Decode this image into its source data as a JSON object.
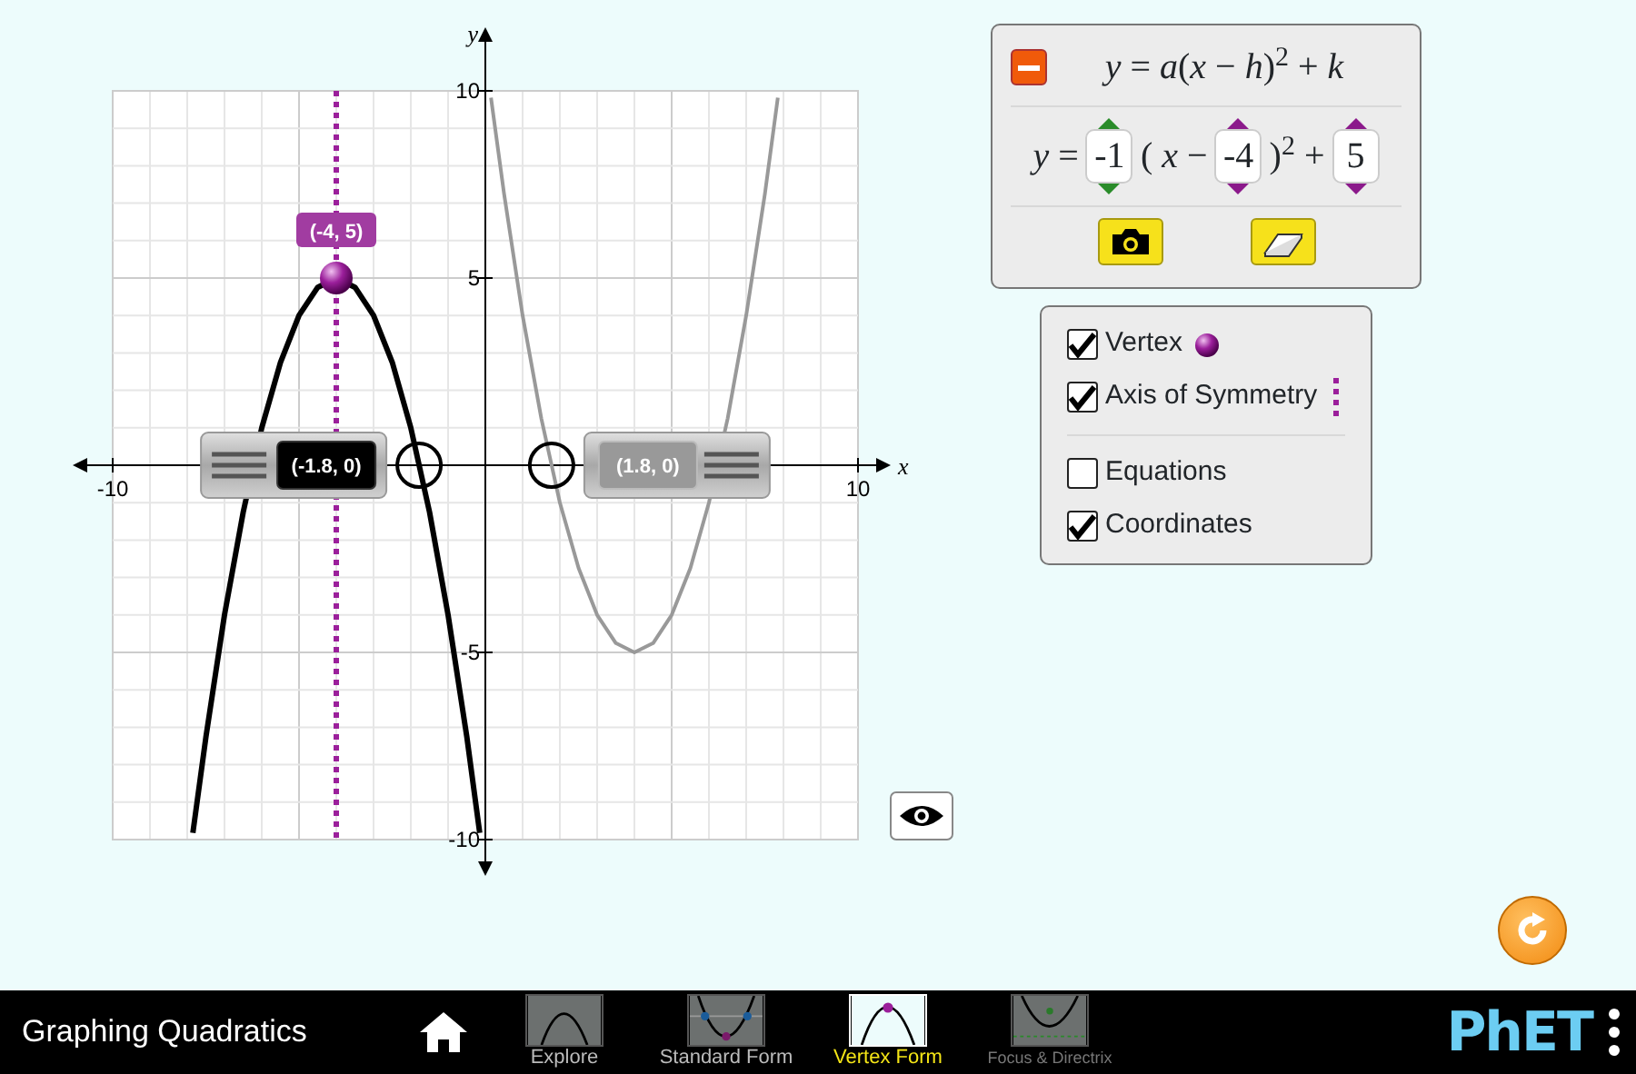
{
  "graph": {
    "chart_data": {
      "type": "line",
      "xlabel": "x",
      "ylabel": "y",
      "xlim": [
        -10,
        10
      ],
      "ylim": [
        -10,
        10
      ],
      "xticks": [
        -10,
        10
      ],
      "yticks": [
        -10,
        -5,
        5,
        10
      ],
      "x": [
        -7.85,
        -7.5,
        -7,
        -6.5,
        -6,
        -5.5,
        -5,
        -4.5,
        -4,
        -3.5,
        -3,
        -2.5,
        -2,
        -1.5,
        -1,
        -0.5,
        -0.15,
        0.15,
        0.5,
        1,
        1.5,
        2,
        2.5,
        3,
        3.5,
        4,
        4.5,
        5,
        5.5,
        6,
        6.5,
        7,
        7.5,
        7.85
      ],
      "series": [
        {
          "color": "#000000",
          "values": [
            -9.82,
            -7.25,
            -4,
            -1.25,
            1,
            2.75,
            4,
            4.75,
            5,
            4.75,
            4,
            2.75,
            1,
            -1.25,
            -4,
            -7.25,
            -9.82,
            null,
            null,
            null,
            null,
            null,
            null,
            null,
            null,
            null,
            null,
            null,
            null,
            null,
            null,
            null,
            null,
            null
          ]
        },
        {
          "color": "#999999",
          "values": [
            null,
            null,
            null,
            null,
            null,
            null,
            null,
            null,
            null,
            null,
            null,
            null,
            null,
            null,
            null,
            null,
            null,
            9.82,
            7.25,
            4,
            1.25,
            -1,
            -2.75,
            -4,
            -4.75,
            -5,
            -4.75,
            -4,
            -2.75,
            -1,
            1.25,
            4,
            7.25,
            9.82
          ]
        }
      ],
      "ref_lines": [
        {
          "axis": "x",
          "value": -4,
          "color": "#9b1f9b"
        }
      ]
    },
    "labels": [
      {
        "kind": "vertex",
        "text": "(-4, 5)"
      },
      {
        "kind": "root-left",
        "text": "(-1.8, 0)"
      },
      {
        "kind": "root-right",
        "text": "(1.8, 0)"
      }
    ]
  },
  "equation_panel": {
    "expanded": true,
    "form": "*y* = *a*(*x* − *h*)$^{2}$ + *k*",
    "parts": [
      {
        "kind": "text",
        "text": "*y* ="
      },
      {
        "kind": "spinner",
        "value": "-1",
        "color": "#2a8c2a"
      },
      {
        "kind": "text",
        "text": "( *x* −"
      },
      {
        "kind": "spinner",
        "value": "-4",
        "color": "#8b1a8b"
      },
      {
        "kind": "text",
        "text": ")$^{2}$ +"
      },
      {
        "kind": "spinner",
        "value": "5",
        "color": "#8b1a8b"
      }
    ]
  },
  "checkbox_groups": [
    [
      {
        "kind": "vertex",
        "label": "Vertex",
        "checked": true
      },
      {
        "kind": "axis",
        "label": "Axis of Symmetry",
        "checked": true
      }
    ],
    [
      {
        "kind": "plain",
        "label": "Equations",
        "checked": false
      },
      {
        "kind": "plain",
        "label": "Coordinates",
        "checked": true
      }
    ]
  ],
  "navbar": {
    "title": "Graphing Quadratics",
    "logo": "PhET",
    "tabs": [
      {
        "kind": "explore",
        "label": "Explore",
        "selected": false
      },
      {
        "kind": "standard",
        "label": "Standard Form",
        "selected": false
      },
      {
        "kind": "vertex",
        "label": "Vertex Form",
        "selected": true
      },
      {
        "kind": "focus",
        "label": "Focus & Directrix",
        "selected": false
      }
    ]
  }
}
